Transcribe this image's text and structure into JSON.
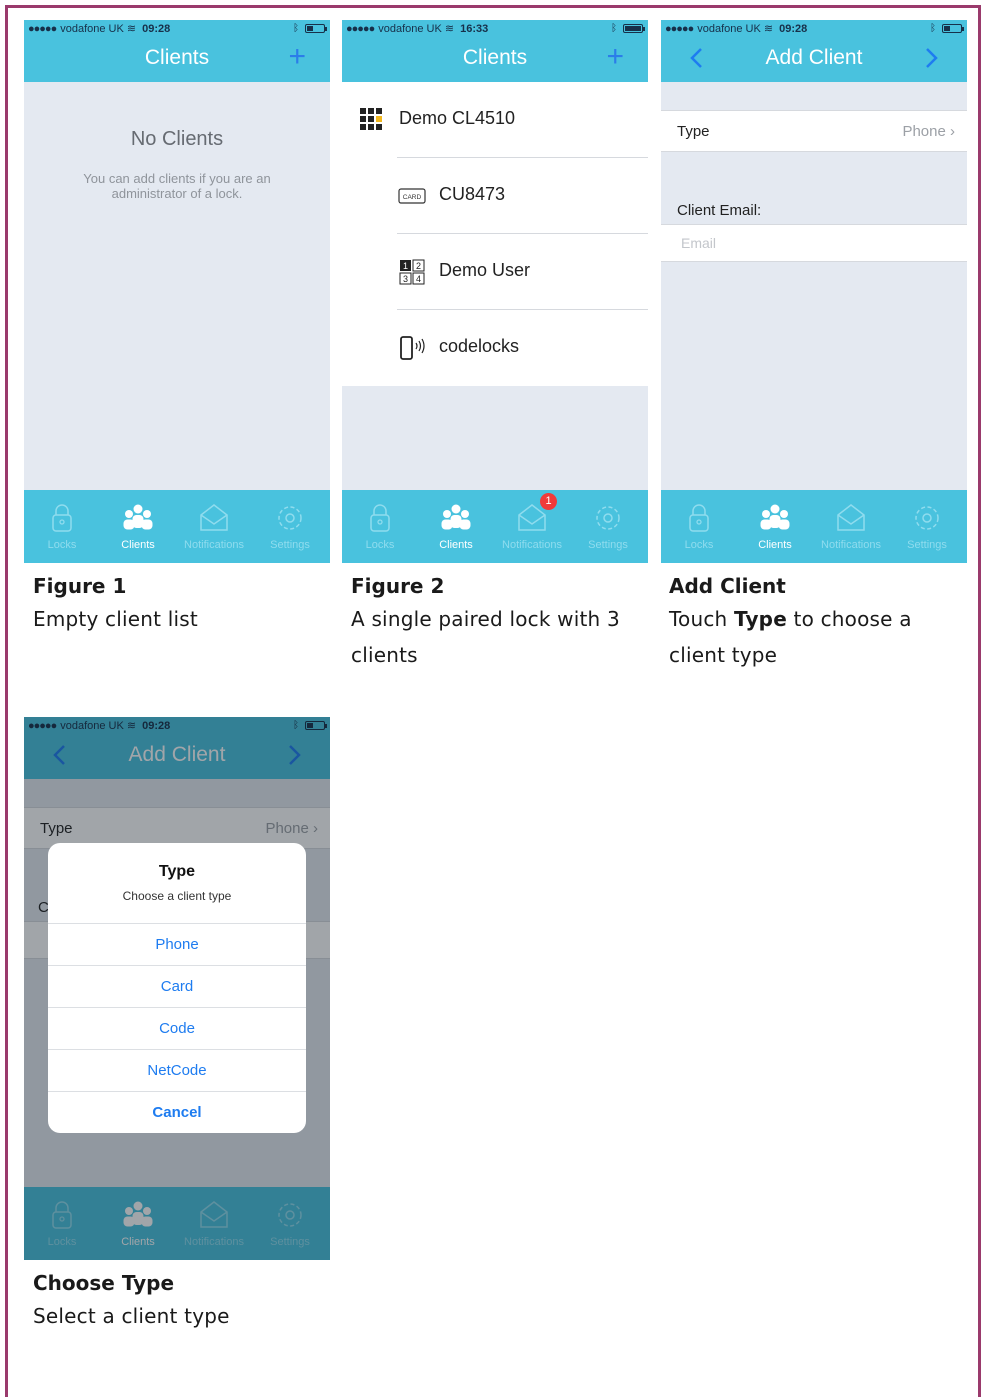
{
  "colors": {
    "frame": "#9a3a6c",
    "bar": "#49c2de",
    "accent": "#1e7cf0",
    "badge": "#f03a3a"
  },
  "status": {
    "carrier": "vodafone UK",
    "time_a": "09:28",
    "time_b": "16:33"
  },
  "tabs": {
    "locks": "Locks",
    "clients": "Clients",
    "notifications": "Notifications",
    "settings": "Settings",
    "badge_count": "1"
  },
  "screen1": {
    "title": "Clients",
    "add_icon": "plus-icon",
    "empty_title": "No Clients",
    "empty_text": "You can add clients if you are an administrator of a lock."
  },
  "screen2": {
    "title": "Clients",
    "clients": [
      {
        "label": "Demo CL4510",
        "icon": "keypad-lock-icon"
      },
      {
        "label": "CU8473",
        "icon": "card-icon"
      },
      {
        "label": "Demo User",
        "icon": "code-grid-icon"
      },
      {
        "label": "codelocks",
        "icon": "phone-signal-icon"
      }
    ]
  },
  "screen3": {
    "title": "Add Client",
    "type_label": "Type",
    "type_value": "Phone",
    "email_label": "Client Email:",
    "email_placeholder": "Email"
  },
  "screen4": {
    "title": "Add Client",
    "type_label": "Type",
    "type_value": "Phone",
    "partial_label": "C",
    "sheet": {
      "title": "Type",
      "message": "Choose a client type",
      "options": [
        "Phone",
        "Card",
        "Code",
        "NetCode"
      ],
      "cancel": "Cancel"
    }
  },
  "captions": {
    "fig1_title": "Figure 1",
    "fig1_desc": "Empty client list",
    "fig2_title": "Figure 2",
    "fig2_desc": "A single paired lock with 3 clients",
    "fig3_title": "Add Client",
    "fig3_desc_pre": "Touch",
    "fig3_desc_bold": "Type",
    "fig3_desc_post": "to choose a client type",
    "fig4_title": "Choose Type",
    "fig4_desc": "Select a client type"
  }
}
